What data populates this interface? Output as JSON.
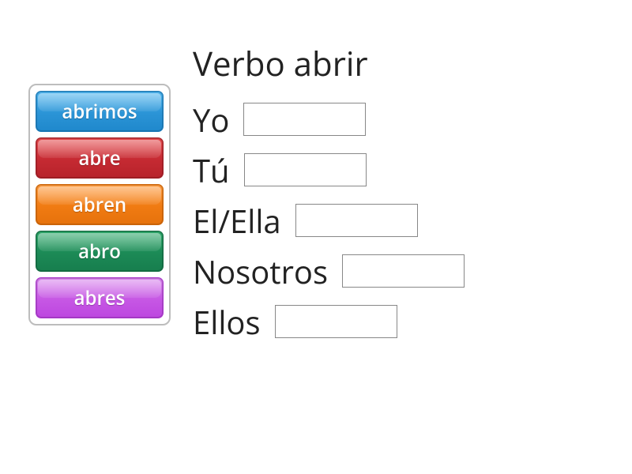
{
  "title": "Verbo abrir",
  "tiles": [
    {
      "label": "abrimos",
      "color": "blue"
    },
    {
      "label": "abre",
      "color": "red"
    },
    {
      "label": "abren",
      "color": "orange"
    },
    {
      "label": "abro",
      "color": "green"
    },
    {
      "label": "abres",
      "color": "purple"
    }
  ],
  "rows": [
    {
      "pronoun": "Yo"
    },
    {
      "pronoun": "Tú"
    },
    {
      "pronoun": "El/Ella"
    },
    {
      "pronoun": "Nosotros"
    },
    {
      "pronoun": "Ellos"
    }
  ]
}
